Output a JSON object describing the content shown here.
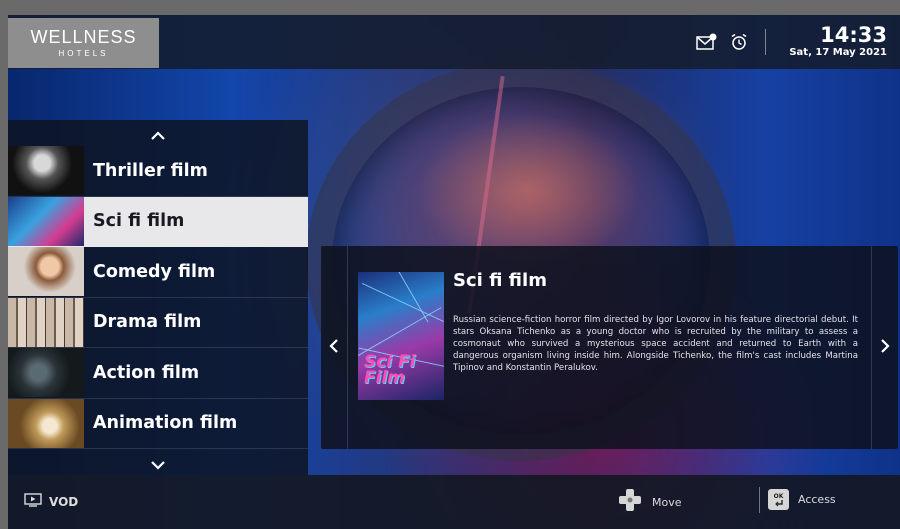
{
  "brand": {
    "name": "WELLNESS",
    "subtitle": "HOTELS"
  },
  "status": {
    "time": "14:33",
    "date": "Sat, 17 May 2021"
  },
  "icons": {
    "messages": "mail-notification-icon",
    "alarm": "alarm-clock-icon"
  },
  "categories": {
    "items": [
      {
        "label": "Thriller film",
        "active": false
      },
      {
        "label": "Sci fi film",
        "active": true
      },
      {
        "label": "Comedy film",
        "active": false
      },
      {
        "label": "Drama film",
        "active": false
      },
      {
        "label": "Action film",
        "active": false
      },
      {
        "label": "Animation film",
        "active": false
      }
    ]
  },
  "detail": {
    "title": "Sci fi film",
    "poster_text": "Sci Fi\nFilm",
    "description": "Russian science-fiction horror film directed by Igor Lovorov in his feature directorial debut. It stars Oksana Tichenko as a young doctor who is recruited by the military to assess a cosmonaut who survived a mysterious space accident and returned to Earth with a dangerous organism living inside him. Alongside Tichenko, the film's cast includes Martina Tipinov and Konstantin Peralukov."
  },
  "footer": {
    "section": "VOD",
    "move_label": "Move",
    "ok_key": "OK",
    "access_label": "Access"
  },
  "colors": {
    "active_item_bg": "#e8e8ea",
    "logo_bg": "#8e8e8e",
    "panel_bg": "#0e121e"
  }
}
